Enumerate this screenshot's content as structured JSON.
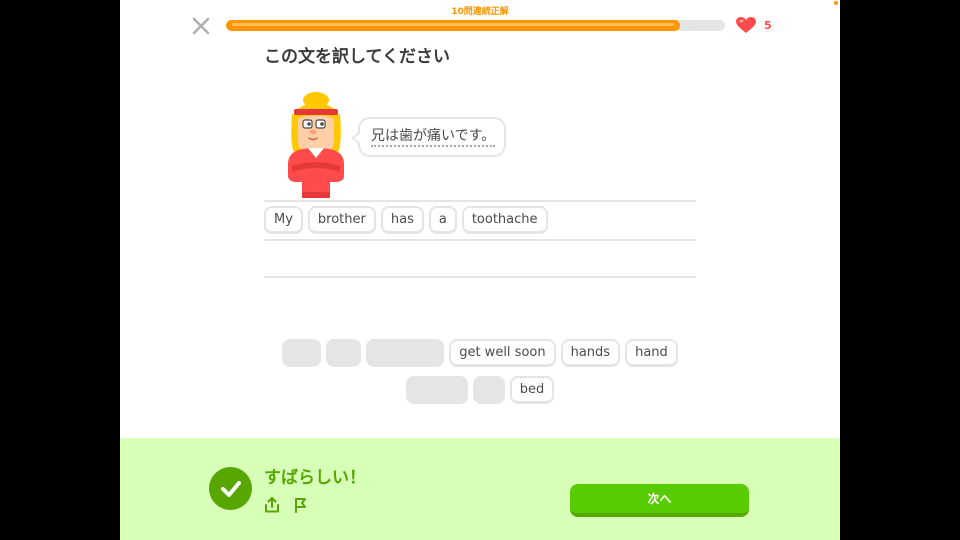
{
  "header": {
    "streak_text": "10問連続正解",
    "progress": 0.91,
    "hearts_count": "5"
  },
  "prompt": {
    "title": "この文を訳してください",
    "sentence": "兄は歯が痛いです。"
  },
  "answer_tiles": [
    "My",
    "brother",
    "has",
    "a",
    "toothache"
  ],
  "word_bank": {
    "row1": [
      "get well soon",
      "hands",
      "hand"
    ],
    "row2": [
      "bed"
    ]
  },
  "feedback": {
    "message": "すばらしい！",
    "next_label": "次へ"
  },
  "colors": {
    "accent": "#ff9600",
    "heart": "#ff4b4b",
    "correct_bg": "#d7ffb8",
    "correct_text": "#58a700",
    "button": "#58cc02"
  },
  "icons": [
    "close-icon",
    "heart-icon",
    "check-icon",
    "share-icon",
    "flag-icon"
  ]
}
